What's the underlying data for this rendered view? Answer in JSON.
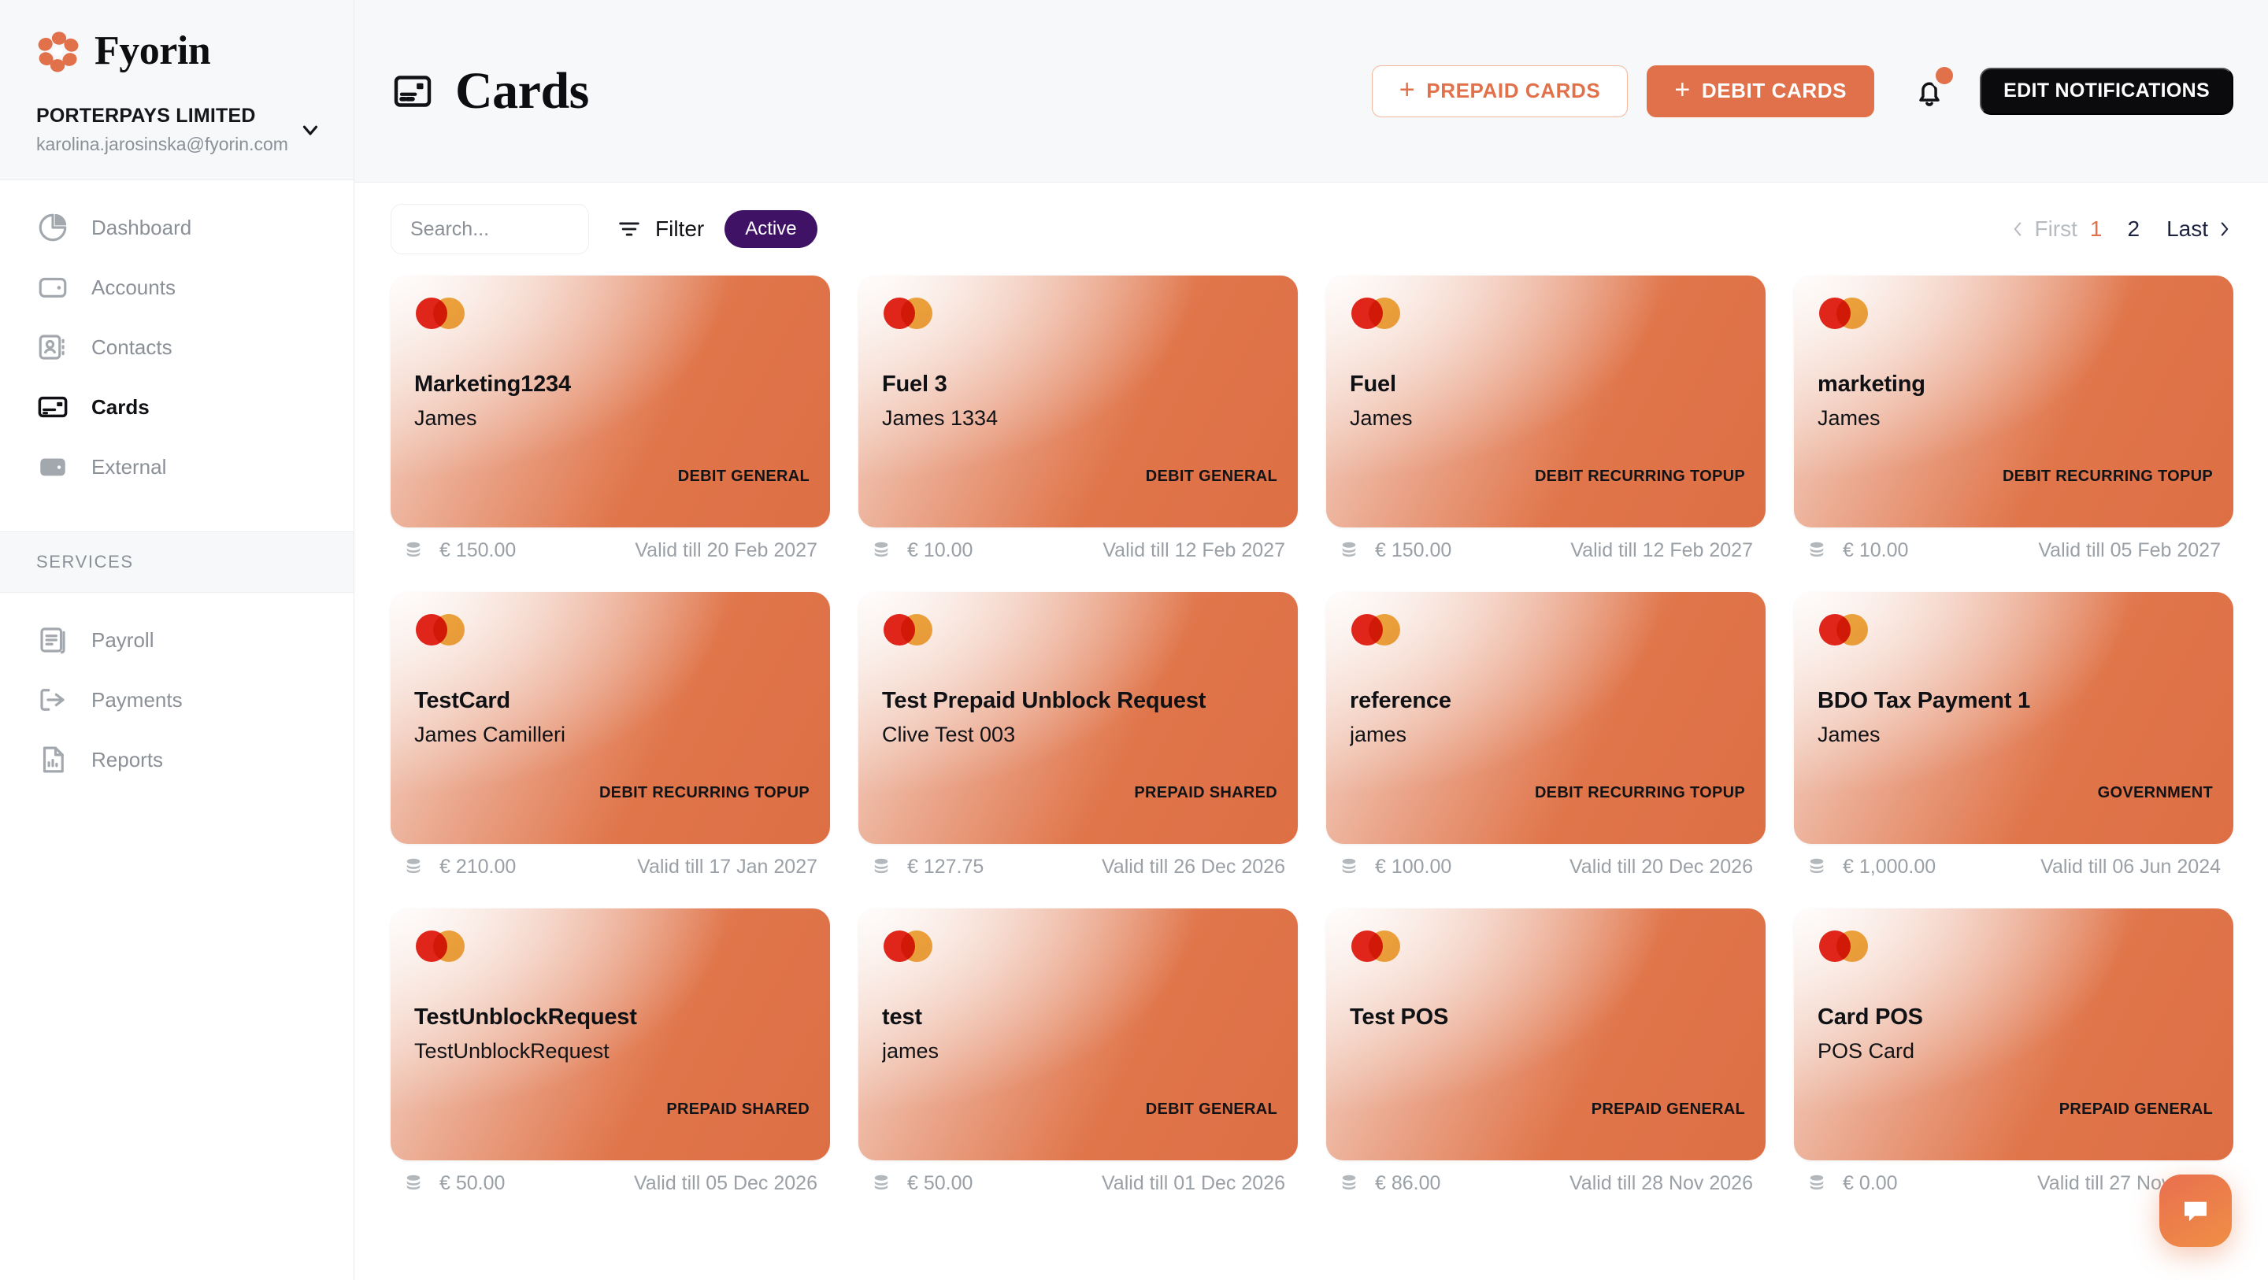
{
  "brand": {
    "name": "Fyorin",
    "logo_icon": "fyorin-flower-logo"
  },
  "org": {
    "name": "PORTERPAYS LIMITED",
    "email": "karolina.jarosinska@fyorin.com",
    "chevron_icon": "chevron-down-icon"
  },
  "sidebar": {
    "items": [
      {
        "label": "Dashboard",
        "icon": "pie-chart-icon",
        "active": false
      },
      {
        "label": "Accounts",
        "icon": "wallet-icon",
        "active": false
      },
      {
        "label": "Contacts",
        "icon": "contact-book-icon",
        "active": false
      },
      {
        "label": "Cards",
        "icon": "card-icon",
        "active": true
      },
      {
        "label": "External",
        "icon": "external-wallet-icon",
        "active": false
      }
    ],
    "section_label": "SERVICES",
    "services": [
      {
        "label": "Payroll",
        "icon": "payroll-document-icon"
      },
      {
        "label": "Payments",
        "icon": "payments-arrow-icon"
      },
      {
        "label": "Reports",
        "icon": "reports-chart-icon"
      }
    ]
  },
  "header": {
    "title": "Cards",
    "title_icon": "card-icon",
    "prepaid_button": "PREPAID CARDS",
    "debit_button": "DEBIT CARDS",
    "plus_glyph": "+",
    "bell_icon": "notification-bell-icon",
    "edit_notifications_button": "EDIT NOTIFICATIONS",
    "colors": {
      "accent": "#e0714a",
      "dark": "#0b0b0d",
      "badge_purple": "#3f1265"
    }
  },
  "toolbar": {
    "search_placeholder": "Search...",
    "search_value": "",
    "filter_label": "Filter",
    "filter_icon": "filter-lines-icon",
    "active_pill": "Active"
  },
  "pagination": {
    "first_label": "First",
    "last_label": "Last",
    "pages": [
      "1",
      "2"
    ],
    "current_page": "1",
    "prev_icon": "chevron-left-icon",
    "next_icon": "chevron-right-icon"
  },
  "cards": [
    {
      "name": "Marketing1234",
      "holder": "James",
      "type": "DEBIT GENERAL",
      "balance": "€ 150.00",
      "valid": "Valid till 20 Feb 2027"
    },
    {
      "name": "Fuel 3",
      "holder": "James 1334",
      "type": "DEBIT GENERAL",
      "balance": "€ 10.00",
      "valid": "Valid till 12 Feb 2027"
    },
    {
      "name": "Fuel",
      "holder": "James",
      "type": "DEBIT RECURRING TOPUP",
      "balance": "€ 150.00",
      "valid": "Valid till 12 Feb 2027"
    },
    {
      "name": "marketing",
      "holder": "James",
      "type": "DEBIT RECURRING TOPUP",
      "balance": "€ 10.00",
      "valid": "Valid till 05 Feb 2027"
    },
    {
      "name": "TestCard",
      "holder": "James Camilleri",
      "type": "DEBIT RECURRING TOPUP",
      "balance": "€ 210.00",
      "valid": "Valid till 17 Jan 2027"
    },
    {
      "name": "Test Prepaid Unblock Request",
      "holder": "Clive Test 003",
      "type": "PREPAID SHARED",
      "balance": "€ 127.75",
      "valid": "Valid till 26 Dec 2026"
    },
    {
      "name": "reference",
      "holder": "james",
      "type": "DEBIT RECURRING TOPUP",
      "balance": "€ 100.00",
      "valid": "Valid till 20 Dec 2026"
    },
    {
      "name": "BDO Tax Payment 1",
      "holder": "James",
      "type": "GOVERNMENT",
      "balance": "€ 1,000.00",
      "valid": "Valid till 06 Jun 2024"
    },
    {
      "name": "TestUnblockRequest",
      "holder": "TestUnblockRequest",
      "type": "PREPAID SHARED",
      "balance": "€ 50.00",
      "valid": "Valid till 05 Dec 2026"
    },
    {
      "name": "test",
      "holder": "james",
      "type": "DEBIT GENERAL",
      "balance": "€ 50.00",
      "valid": "Valid till 01 Dec 2026"
    },
    {
      "name": "Test POS",
      "holder": "",
      "type": "PREPAID GENERAL",
      "balance": "€ 86.00",
      "valid": "Valid till 28 Nov 2026"
    },
    {
      "name": "Card POS",
      "holder": "POS Card",
      "type": "PREPAID GENERAL",
      "balance": "€ 0.00",
      "valid": "Valid till 27 Nov 2026"
    }
  ],
  "card_icons": {
    "brand_logo": "mastercard-logo",
    "balance_icon": "coins-stack-icon"
  },
  "chat": {
    "icon": "chat-bubble-icon"
  }
}
